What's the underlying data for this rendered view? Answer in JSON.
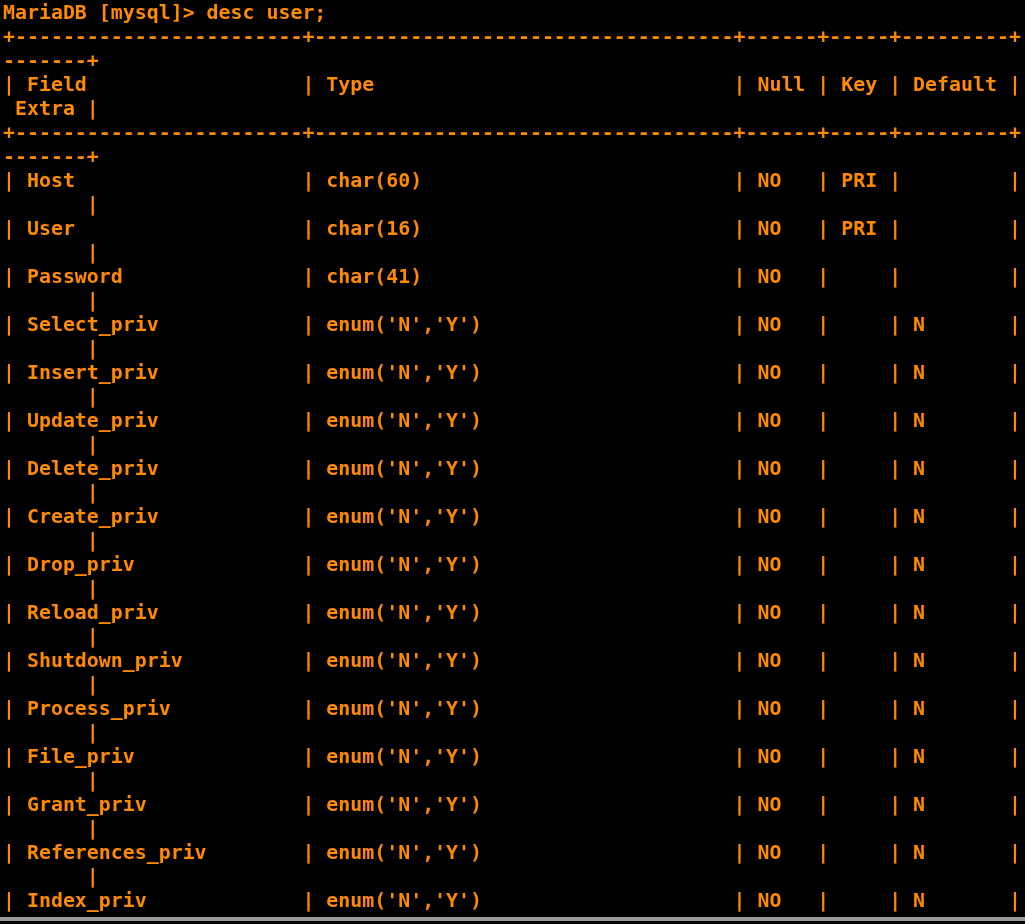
{
  "terminal": {
    "prompt": "MariaDB [mysql]> desc user;",
    "output_lines": [
      "+------------------------+-----------------------------------+------+-----+---------+",
      "-------+",
      "| Field                  | Type                              | Null | Key | Default |",
      " Extra |",
      "+------------------------+-----------------------------------+------+-----+---------+",
      "-------+",
      "| Host                   | char(60)                          | NO   | PRI |         |",
      "       |",
      "| User                   | char(16)                          | NO   | PRI |         |",
      "       |",
      "| Password               | char(41)                          | NO   |     |         |",
      "       |",
      "| Select_priv            | enum('N','Y')                     | NO   |     | N       |",
      "       |",
      "| Insert_priv            | enum('N','Y')                     | NO   |     | N       |",
      "       |",
      "| Update_priv            | enum('N','Y')                     | NO   |     | N       |",
      "       |",
      "| Delete_priv            | enum('N','Y')                     | NO   |     | N       |",
      "       |",
      "| Create_priv            | enum('N','Y')                     | NO   |     | N       |",
      "       |",
      "| Drop_priv              | enum('N','Y')                     | NO   |     | N       |",
      "       |",
      "| Reload_priv            | enum('N','Y')                     | NO   |     | N       |",
      "       |",
      "| Shutdown_priv          | enum('N','Y')                     | NO   |     | N       |",
      "       |",
      "| Process_priv           | enum('N','Y')                     | NO   |     | N       |",
      "       |",
      "| File_priv              | enum('N','Y')                     | NO   |     | N       |",
      "       |",
      "| Grant_priv             | enum('N','Y')                     | NO   |     | N       |",
      "       |",
      "| References_priv        | enum('N','Y')                     | NO   |     | N       |",
      "       |",
      "| Index_priv             | enum('N','Y')                     | NO   |     | N       |"
    ]
  }
}
